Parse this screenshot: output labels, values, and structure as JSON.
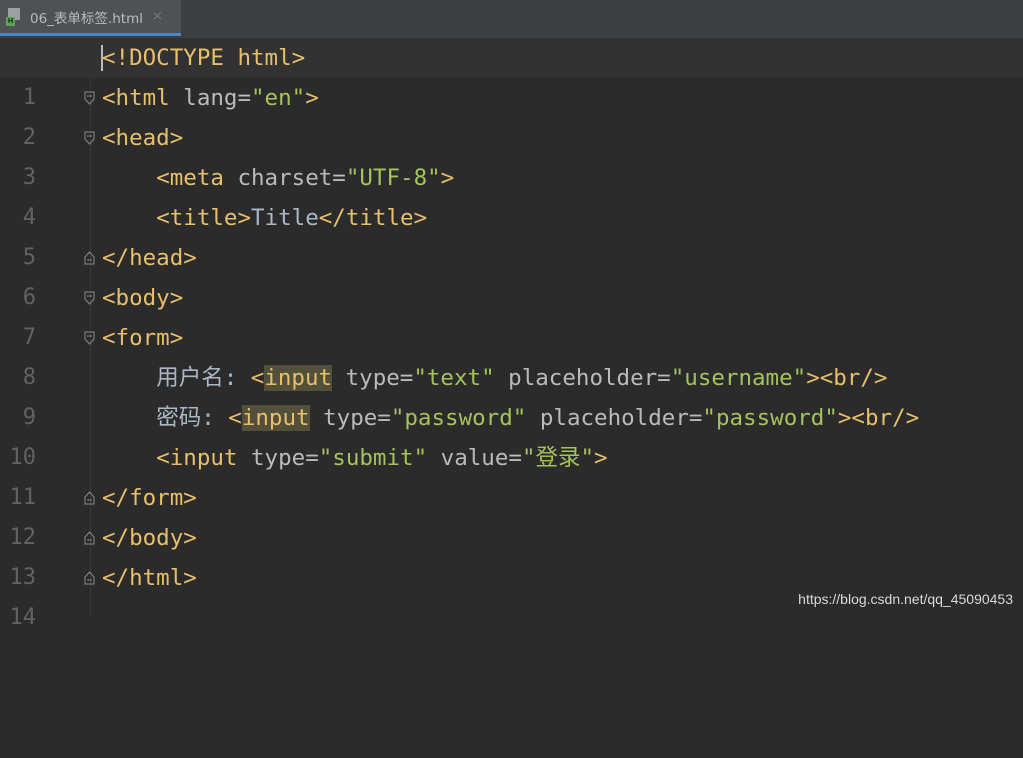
{
  "tab": {
    "filename": "06_表单标签.html",
    "close_glyph": "×",
    "icon_badge": "H"
  },
  "editor": {
    "line_numbers": [
      "1",
      "2",
      "3",
      "4",
      "5",
      "6",
      "7",
      "8",
      "9",
      "10",
      "11",
      "12",
      "13",
      "14"
    ],
    "lines": {
      "l1": "<!DOCTYPE html>",
      "l2": {
        "open": "<html ",
        "attr": "lang=",
        "val": "\"en\"",
        "close": ">"
      },
      "l3": "<head>",
      "l4": {
        "indent": "    ",
        "open": "<meta ",
        "attr": "charset=",
        "val": "\"UTF-8\"",
        "close": ">"
      },
      "l5": {
        "indent": "    ",
        "open": "<title>",
        "text": "Title",
        "close": "</title>"
      },
      "l6": "</head>",
      "l7": "<body>",
      "l8": "<form>",
      "l9": {
        "indent": "    ",
        "label": "用户名: ",
        "lt": "<",
        "input": "input",
        "attr1": " type=",
        "val1": "\"text\"",
        "attr2": " placeholder=",
        "val2": "\"username\"",
        "close": "><br/>"
      },
      "l10": {
        "indent": "    ",
        "label": "密码: ",
        "lt": "<",
        "input": "input",
        "attr1": " type=",
        "val1": "\"password\"",
        "attr2": " placeholder=",
        "val2": "\"password\"",
        "close": "><br/>"
      },
      "l11": {
        "indent": "    ",
        "open": "<input ",
        "attr1": "type=",
        "val1": "\"submit\"",
        "attr2": " value=",
        "val2": "\"登录\"",
        "close": ">"
      },
      "l12": "</form>",
      "l13": "</body>",
      "l14": "</html>"
    }
  },
  "watermark": "https://blog.csdn.net/qq_45090453",
  "colors": {
    "background": "#2b2b2b",
    "tag": "#e8bf6a",
    "attribute": "#bababa",
    "string": "#a5c25c",
    "text": "#a9b7c6",
    "line_number": "#606366",
    "highlight": "#52503a",
    "tab_underline": "#4a88c7"
  }
}
